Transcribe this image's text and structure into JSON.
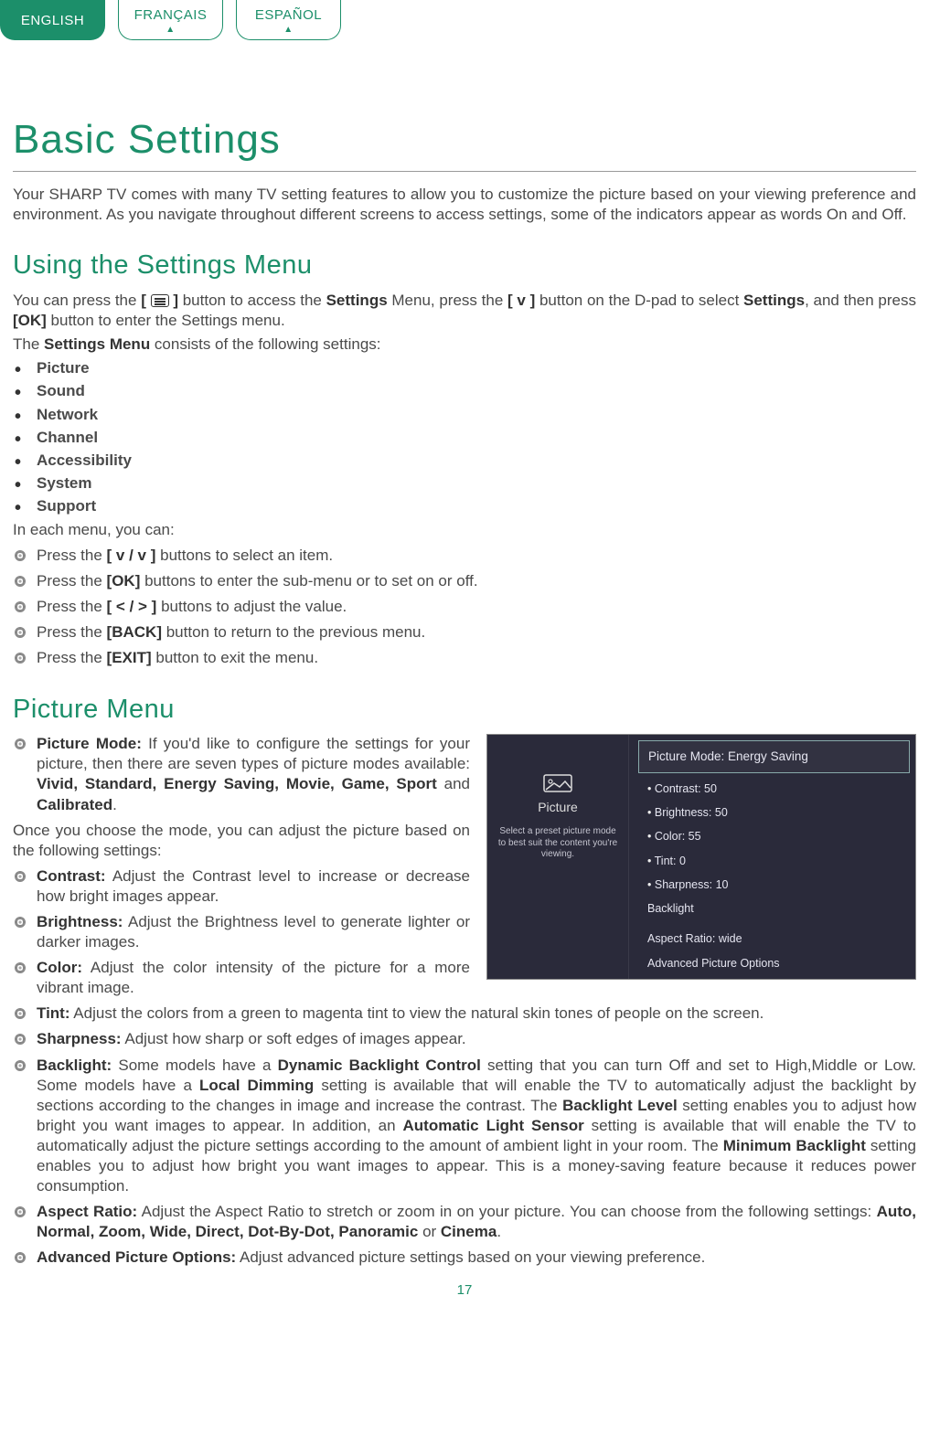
{
  "tabs": {
    "english": "ENGLISH",
    "francais": "FRANÇAIS",
    "espanol": "ESPAÑOL"
  },
  "title": "Basic Settings",
  "intro": "Your SHARP TV comes with many TV setting features to allow you to customize the picture based on your viewing preference and environment. As you navigate throughout different screens to access settings, some of the indicators appear as words On and Off.",
  "s1": {
    "heading": "Using the Settings Menu",
    "p1a": "You can press the ",
    "p1b": " button to access the ",
    "p1c": " Menu, press the ",
    "p1d": " button on the D-pad to select ",
    "p1e": ", and then press ",
    "p1f": " button to enter the Settings menu.",
    "settings_word": "Settings",
    "vbtn": "[ v ]",
    "okbtn": "[OK]",
    "p2a": "The ",
    "p2b": " consists of the following settings:",
    "settings_menu": "Settings Menu",
    "list": [
      "Picture",
      "Sound",
      "Network",
      "Channel",
      "Accessibility",
      "System",
      "Support"
    ],
    "p3": "In each menu, you can:",
    "actions": [
      {
        "a": "Press the ",
        "b": "[ v / v ]",
        "c": " buttons to select an item."
      },
      {
        "a": "Press the ",
        "b": "[OK]",
        "c": " buttons to enter the sub-menu or to set on or off."
      },
      {
        "a": "Press the ",
        "b": "[ < / > ]",
        "c": " buttons to adjust the value."
      },
      {
        "a": "Press the ",
        "b": "[BACK]",
        "c": " button to return to the previous menu."
      },
      {
        "a": "Press the ",
        "b": "[EXIT]",
        "c": " button to exit the menu."
      }
    ]
  },
  "s2": {
    "heading": "Picture Menu",
    "tv": {
      "left_label": "Picture",
      "left_help": "Select a preset picture mode to best suit the content you're viewing.",
      "rows": {
        "mode": "Picture Mode: Energy Saving",
        "contrast": "Contrast: 50",
        "brightness": "Brightness: 50",
        "color": "Color: 55",
        "tint": "Tint: 0",
        "sharpness": "Sharpness: 10",
        "backlight": "Backlight",
        "aspect": "Aspect Ratio: wide",
        "advanced": "Advanced Picture Options"
      }
    },
    "pm_a": "Picture Mode:",
    "pm_b": " If you'd like to configure the settings for your picture, then there are seven types of picture modes available: ",
    "pm_list": "Vivid, Standard, Energy Saving, Movie, Game, Sport",
    "pm_c": " and ",
    "pm_d": "Calibrated",
    "pm_e": ".",
    "once": "Once you choose the mode, you can adjust the picture based on the following settings:",
    "items": {
      "contrast": {
        "h": "Contrast:",
        "t": " Adjust the Contrast level to increase or decrease how bright images appear."
      },
      "brightness": {
        "h": "Brightness:",
        "t": " Adjust the Brightness level to generate lighter or darker images."
      },
      "color": {
        "h": "Color:",
        "t": " Adjust the color intensity of the picture for a more vibrant image."
      },
      "tint": {
        "h": "Tint:",
        "t": " Adjust the colors from a green to magenta tint to view the natural skin tones of people on the screen."
      },
      "sharpness": {
        "h": "Sharpness:",
        "t": " Adjust how sharp or soft edges of images appear."
      },
      "backlight": {
        "h": "Backlight:",
        "t1": " Some models have a ",
        "b1": "Dynamic Backlight Control",
        "t2": " setting that you can turn Off and set to High,Middle or Low. Some models have a ",
        "b2": "Local Dimming",
        "t3": " setting is available that will enable the TV to automatically adjust the backlight by sections according to the changes in image and increase the contrast. The ",
        "b3": "Backlight Level",
        "t4": " setting enables you to adjust how bright you want images to appear. In addition, an ",
        "b4": "Automatic Light Sensor",
        "t5": " setting is available that will enable the TV to automatically adjust the picture settings according to the amount of ambient light in your room. The ",
        "b5": "Minimum Backlight",
        "t6": " setting enables you to adjust how bright you want images to appear. This is a money-saving feature because it reduces power consumption."
      },
      "aspect": {
        "h": "Aspect Ratio:",
        "t1": " Adjust the Aspect Ratio to stretch or zoom in on your picture. You can choose from the following settings: ",
        "b": "Auto, Normal, Zoom, Wide, Direct, Dot-By-Dot, Panoramic",
        "t2": " or ",
        "b2": "Cinema",
        "t3": "."
      },
      "advanced": {
        "h": "Advanced Picture Options:",
        "t": " Adjust advanced picture settings based on your viewing preference."
      }
    }
  },
  "page_number": "17"
}
